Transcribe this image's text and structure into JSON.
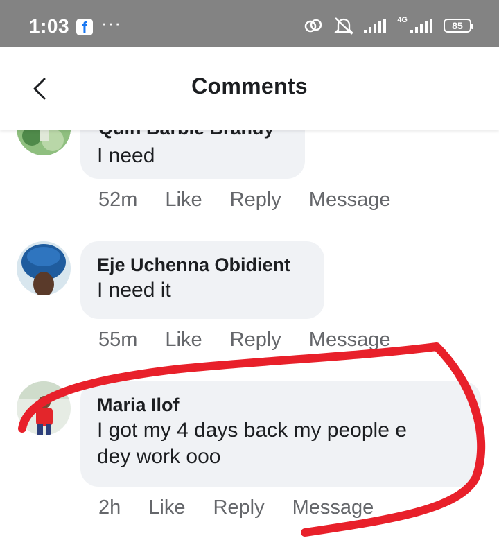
{
  "status_bar": {
    "time": "1:03",
    "app_icon": "facebook-icon",
    "more": "···",
    "network": "4G",
    "battery": "85"
  },
  "header": {
    "back_icon": "chevron-left-icon",
    "title": "Comments"
  },
  "comments": [
    {
      "name": "Quin Barbie Brandy",
      "text": "I need",
      "time": "52m",
      "actions": [
        "Like",
        "Reply",
        "Message"
      ]
    },
    {
      "name": "Eje Uchenna Obidient",
      "text": "I need it",
      "time": "55m",
      "actions": [
        "Like",
        "Reply",
        "Message"
      ]
    },
    {
      "name": "Maria Ilof",
      "text": "I got my 4 days back my people e dey work ooo",
      "time": "2h",
      "actions": [
        "Like",
        "Reply",
        "Message"
      ]
    }
  ],
  "colors": {
    "status_bar": "#838383",
    "bubble": "#f0f2f5",
    "secondary_text": "#65676b",
    "annotation": "#e8202a"
  }
}
